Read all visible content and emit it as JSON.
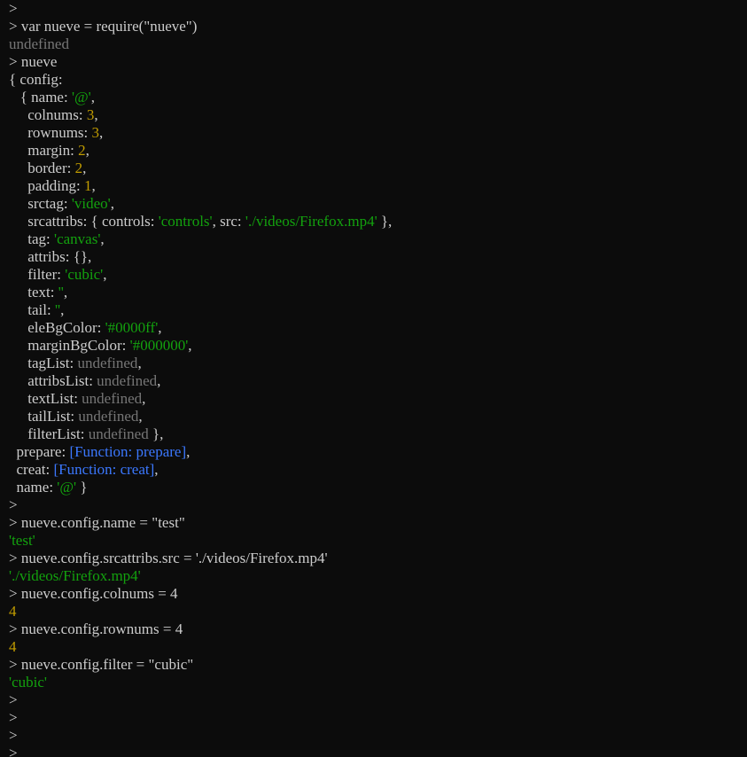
{
  "colors": {
    "background": "#0c0c0c",
    "normal": "#cccccc",
    "string": "#13a10e",
    "number": "#c19c00",
    "undefined": "#767676",
    "function": "#3b78ff"
  },
  "lines": [
    [
      {
        "t": "prompt",
        "v": "> "
      }
    ],
    [
      {
        "t": "prompt",
        "v": "> "
      },
      {
        "t": "normal",
        "v": "var nueve = require(\"nueve\")"
      }
    ],
    [
      {
        "t": "undef",
        "v": "undefined"
      }
    ],
    [
      {
        "t": "prompt",
        "v": "> "
      },
      {
        "t": "normal",
        "v": "nueve"
      }
    ],
    [
      {
        "t": "normal",
        "v": "{ config:"
      }
    ],
    [
      {
        "t": "normal",
        "v": "   { name: "
      },
      {
        "t": "str",
        "v": "'@'"
      },
      {
        "t": "normal",
        "v": ","
      }
    ],
    [
      {
        "t": "normal",
        "v": "     colnums: "
      },
      {
        "t": "num",
        "v": "3"
      },
      {
        "t": "normal",
        "v": ","
      }
    ],
    [
      {
        "t": "normal",
        "v": "     rownums: "
      },
      {
        "t": "num",
        "v": "3"
      },
      {
        "t": "normal",
        "v": ","
      }
    ],
    [
      {
        "t": "normal",
        "v": "     margin: "
      },
      {
        "t": "num",
        "v": "2"
      },
      {
        "t": "normal",
        "v": ","
      }
    ],
    [
      {
        "t": "normal",
        "v": "     border: "
      },
      {
        "t": "num",
        "v": "2"
      },
      {
        "t": "normal",
        "v": ","
      }
    ],
    [
      {
        "t": "normal",
        "v": "     padding: "
      },
      {
        "t": "num",
        "v": "1"
      },
      {
        "t": "normal",
        "v": ","
      }
    ],
    [
      {
        "t": "normal",
        "v": "     srctag: "
      },
      {
        "t": "str",
        "v": "'video'"
      },
      {
        "t": "normal",
        "v": ","
      }
    ],
    [
      {
        "t": "normal",
        "v": "     srcattribs: { controls: "
      },
      {
        "t": "str",
        "v": "'controls'"
      },
      {
        "t": "normal",
        "v": ", src: "
      },
      {
        "t": "str",
        "v": "'./videos/Firefox.mp4'"
      },
      {
        "t": "normal",
        "v": " },"
      }
    ],
    [
      {
        "t": "normal",
        "v": "     tag: "
      },
      {
        "t": "str",
        "v": "'canvas'"
      },
      {
        "t": "normal",
        "v": ","
      }
    ],
    [
      {
        "t": "normal",
        "v": "     attribs: {},"
      }
    ],
    [
      {
        "t": "normal",
        "v": "     filter: "
      },
      {
        "t": "str",
        "v": "'cubic'"
      },
      {
        "t": "normal",
        "v": ","
      }
    ],
    [
      {
        "t": "normal",
        "v": "     text: "
      },
      {
        "t": "str",
        "v": "''"
      },
      {
        "t": "normal",
        "v": ","
      }
    ],
    [
      {
        "t": "normal",
        "v": "     tail: "
      },
      {
        "t": "str",
        "v": "''"
      },
      {
        "t": "normal",
        "v": ","
      }
    ],
    [
      {
        "t": "normal",
        "v": "     eleBgColor: "
      },
      {
        "t": "str",
        "v": "'#0000ff'"
      },
      {
        "t": "normal",
        "v": ","
      }
    ],
    [
      {
        "t": "normal",
        "v": "     marginBgColor: "
      },
      {
        "t": "str",
        "v": "'#000000'"
      },
      {
        "t": "normal",
        "v": ","
      }
    ],
    [
      {
        "t": "normal",
        "v": "     tagList: "
      },
      {
        "t": "undef",
        "v": "undefined"
      },
      {
        "t": "normal",
        "v": ","
      }
    ],
    [
      {
        "t": "normal",
        "v": "     attribsList: "
      },
      {
        "t": "undef",
        "v": "undefined"
      },
      {
        "t": "normal",
        "v": ","
      }
    ],
    [
      {
        "t": "normal",
        "v": "     textList: "
      },
      {
        "t": "undef",
        "v": "undefined"
      },
      {
        "t": "normal",
        "v": ","
      }
    ],
    [
      {
        "t": "normal",
        "v": "     tailList: "
      },
      {
        "t": "undef",
        "v": "undefined"
      },
      {
        "t": "normal",
        "v": ","
      }
    ],
    [
      {
        "t": "normal",
        "v": "     filterList: "
      },
      {
        "t": "undef",
        "v": "undefined"
      },
      {
        "t": "normal",
        "v": " },"
      }
    ],
    [
      {
        "t": "normal",
        "v": "  prepare: "
      },
      {
        "t": "func",
        "v": "[Function: prepare]"
      },
      {
        "t": "normal",
        "v": ","
      }
    ],
    [
      {
        "t": "normal",
        "v": "  creat: "
      },
      {
        "t": "func",
        "v": "[Function: creat]"
      },
      {
        "t": "normal",
        "v": ","
      }
    ],
    [
      {
        "t": "normal",
        "v": "  name: "
      },
      {
        "t": "str",
        "v": "'@'"
      },
      {
        "t": "normal",
        "v": " }"
      }
    ],
    [
      {
        "t": "prompt",
        "v": "> "
      }
    ],
    [
      {
        "t": "prompt",
        "v": "> "
      },
      {
        "t": "normal",
        "v": "nueve.config.name = \"test\""
      }
    ],
    [
      {
        "t": "str",
        "v": "'test'"
      }
    ],
    [
      {
        "t": "prompt",
        "v": "> "
      },
      {
        "t": "normal",
        "v": "nueve.config.srcattribs.src = './videos/Firefox.mp4'"
      }
    ],
    [
      {
        "t": "str",
        "v": "'./videos/Firefox.mp4'"
      }
    ],
    [
      {
        "t": "prompt",
        "v": "> "
      },
      {
        "t": "normal",
        "v": "nueve.config.colnums = 4"
      }
    ],
    [
      {
        "t": "num",
        "v": "4"
      }
    ],
    [
      {
        "t": "prompt",
        "v": "> "
      },
      {
        "t": "normal",
        "v": "nueve.config.rownums = 4"
      }
    ],
    [
      {
        "t": "num",
        "v": "4"
      }
    ],
    [
      {
        "t": "prompt",
        "v": "> "
      },
      {
        "t": "normal",
        "v": "nueve.config.filter = \"cubic\""
      }
    ],
    [
      {
        "t": "str",
        "v": "'cubic'"
      }
    ],
    [
      {
        "t": "prompt",
        "v": "> "
      }
    ],
    [
      {
        "t": "prompt",
        "v": "> "
      }
    ],
    [
      {
        "t": "prompt",
        "v": "> "
      }
    ],
    [
      {
        "t": "prompt",
        "v": "> "
      }
    ]
  ]
}
